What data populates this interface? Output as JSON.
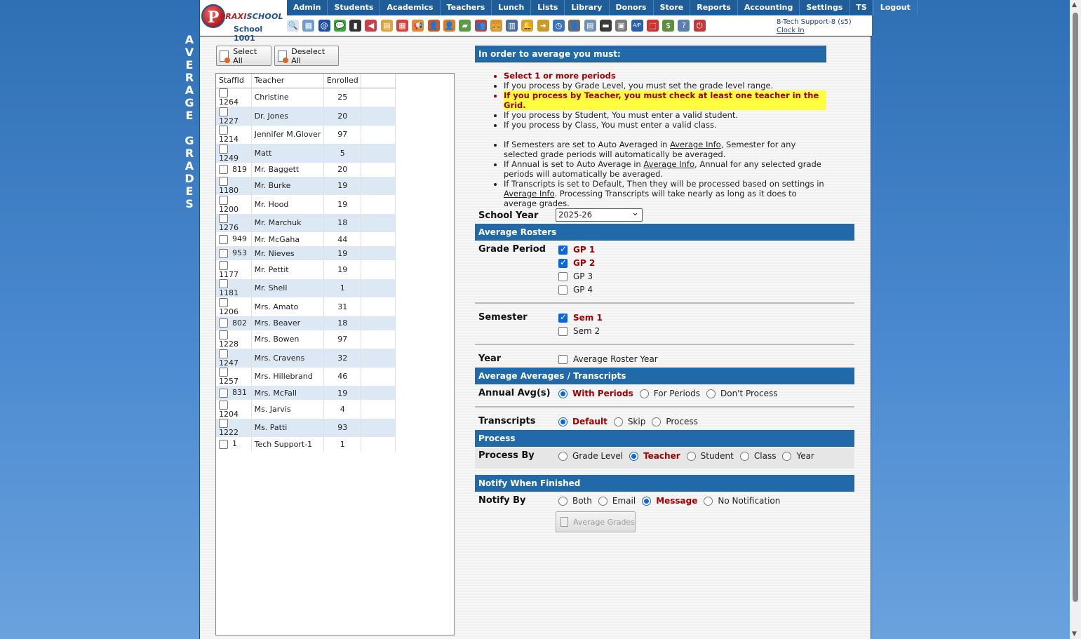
{
  "page": {
    "vertical_title": [
      "A",
      "V",
      "E",
      "R",
      "A",
      "G",
      "E",
      "",
      "G",
      "R",
      "A",
      "D",
      "E",
      "S"
    ]
  },
  "header": {
    "logo_letter": "P",
    "logo_name_a": "PRAXI",
    "logo_name_b": "SCHOOL",
    "school": "School 1001",
    "nav": [
      "Admin",
      "Students",
      "Academics",
      "Teachers",
      "Lunch",
      "Lists",
      "Library",
      "Donors",
      "Store",
      "Reports",
      "Accounting",
      "Settings",
      "TS",
      "Logout"
    ],
    "user": "8-Tech Support-8 (s5)",
    "clock_in": "Clock In",
    "toolbar_icons": [
      {
        "name": "search-icon",
        "glyph": "🔍",
        "color": "#d9e4f2"
      },
      {
        "name": "grid-icon",
        "glyph": "▦",
        "color": "#6f9ccf"
      },
      {
        "name": "email-icon",
        "glyph": "@",
        "color": "#1f4fa8"
      },
      {
        "name": "chat-icon",
        "glyph": "💬",
        "color": "#3fa63f"
      },
      {
        "name": "phone-icon",
        "glyph": "▮",
        "color": "#333"
      },
      {
        "name": "speaker-icon",
        "glyph": "◀",
        "color": "#c7414a"
      },
      {
        "name": "report-icon",
        "glyph": "▤",
        "color": "#d9a441"
      },
      {
        "name": "calendar-icon",
        "glyph": "▦",
        "color": "#d6413c"
      },
      {
        "name": "megaphone-icon",
        "glyph": "📢",
        "color": "#e48a2b"
      },
      {
        "name": "teacher-icon",
        "glyph": "👤",
        "color": "#c05b2b"
      },
      {
        "name": "student-icon",
        "glyph": "👤",
        "color": "#d77b2b"
      },
      {
        "name": "book-icon",
        "glyph": "▰",
        "color": "#5c9a48"
      },
      {
        "name": "group-icon",
        "glyph": "👥",
        "color": "#b5443e"
      },
      {
        "name": "lunch-icon",
        "glyph": "🍔",
        "color": "#d49a2d"
      },
      {
        "name": "list-icon",
        "glyph": "▥",
        "color": "#4b6e98"
      },
      {
        "name": "bell-icon",
        "glyph": "🔔",
        "color": "#d4a52b"
      },
      {
        "name": "export-icon",
        "glyph": "➜",
        "color": "#c79a2a"
      },
      {
        "name": "clock-icon",
        "glyph": "◷",
        "color": "#3b74b8"
      },
      {
        "name": "person-icon",
        "glyph": "👤",
        "color": "#6b6b6b"
      },
      {
        "name": "document-icon",
        "glyph": "▤",
        "color": "#6f8fb3"
      },
      {
        "name": "barcode-icon",
        "glyph": "▬",
        "color": "#3a3a3a"
      },
      {
        "name": "printer-icon",
        "glyph": "▣",
        "color": "#7a7a7a"
      },
      {
        "name": "ap-icon",
        "glyph": "A/P",
        "color": "#2e5fa8"
      },
      {
        "name": "pdf-icon",
        "glyph": "⬚",
        "color": "#c33"
      },
      {
        "name": "money-icon",
        "glyph": "$",
        "color": "#5f8f3e"
      },
      {
        "name": "help-icon",
        "glyph": "?",
        "color": "#5b7fae"
      },
      {
        "name": "power-icon",
        "glyph": "⏻",
        "color": "#c43a3a"
      }
    ]
  },
  "buttons": {
    "select_all": "Select All",
    "deselect_all": "Deselect All",
    "average_grades": "Average Grades"
  },
  "grid": {
    "headers": {
      "staff_id": "StaffId",
      "teacher": "Teacher",
      "enrolled": "Enrolled"
    },
    "rows": [
      {
        "id": "1264",
        "teacher": "Christine",
        "enrolled": "25"
      },
      {
        "id": "1227",
        "teacher": "Dr. Jones",
        "enrolled": "20"
      },
      {
        "id": "1214",
        "teacher": "Jennifer M.Glover",
        "enrolled": "97"
      },
      {
        "id": "1249",
        "teacher": "Matt",
        "enrolled": "5"
      },
      {
        "id": "819",
        "teacher": "Mr. Baggett",
        "enrolled": "20"
      },
      {
        "id": "1180",
        "teacher": "Mr. Burke",
        "enrolled": "19"
      },
      {
        "id": "1200",
        "teacher": "Mr. Hood",
        "enrolled": "19"
      },
      {
        "id": "1276",
        "teacher": "Mr. Marchuk",
        "enrolled": "18"
      },
      {
        "id": "949",
        "teacher": "Mr. McGaha",
        "enrolled": "44"
      },
      {
        "id": "953",
        "teacher": "Mr. Nieves",
        "enrolled": "19"
      },
      {
        "id": "1177",
        "teacher": "Mr. Pettit",
        "enrolled": "19"
      },
      {
        "id": "1181",
        "teacher": "Mr. Shell",
        "enrolled": "1"
      },
      {
        "id": "1206",
        "teacher": "Mrs. Amato",
        "enrolled": "31"
      },
      {
        "id": "802",
        "teacher": "Mrs. Beaver",
        "enrolled": "18"
      },
      {
        "id": "1228",
        "teacher": "Mrs. Bowen",
        "enrolled": "97"
      },
      {
        "id": "1247",
        "teacher": "Mrs. Cravens",
        "enrolled": "32"
      },
      {
        "id": "1257",
        "teacher": "Mrs. Hillebrand",
        "enrolled": "46"
      },
      {
        "id": "831",
        "teacher": "Mrs. McFall",
        "enrolled": "19"
      },
      {
        "id": "1204",
        "teacher": "Ms. Jarvis",
        "enrolled": "4"
      },
      {
        "id": "1222",
        "teacher": "Ms. Patti",
        "enrolled": "93"
      },
      {
        "id": "1",
        "teacher": "Tech Support-1",
        "enrolled": "1"
      }
    ]
  },
  "info": {
    "title": "In order to average you must:",
    "req1": "Select 1 or more periods",
    "req2": "If you process by Grade Level, you must set the grade level range.",
    "req3": "If you process by Teacher, you must check at least one teacher in the Grid.",
    "req4": "If you process by Student, You must enter a valid student.",
    "req5": "If you process by Class, You must enter a valid class.",
    "note1_a": "If Semesters are set to Auto Averaged in ",
    "note1_link": "Average Info",
    "note1_b": ", Semester for any selected grade periods will automatically be averaged.",
    "note2_a": "If Annual is set to Auto Average in ",
    "note2_link": "Average Info",
    "note2_b": ", Annual for any selected grade periods will automatically be averaged.",
    "note3_a": "If Transcripts is set to Default, Then they will be processed based on settings in ",
    "note3_link": "Average Info",
    "note3_b": ". Processing Transcripts will take nearly as long as it does to average grades."
  },
  "form": {
    "school_year_label": "School Year",
    "school_year_value": "2025-26",
    "average_rosters": "Average Rosters",
    "grade_period_label": "Grade Period",
    "gp1": "GP 1",
    "gp2": "GP 2",
    "gp3": "GP 3",
    "gp4": "GP 4",
    "semester_label": "Semester",
    "sem1": "Sem 1",
    "sem2": "Sem 2",
    "year_label": "Year",
    "avg_roster_year": "Average Roster Year",
    "averages_transcripts": "Average Averages / Transcripts",
    "annual_label": "Annual Avg(s)",
    "with_periods": "With Periods",
    "for_periods": "For Periods",
    "dont_process": "Don't Process",
    "transcripts_label": "Transcripts",
    "t_default": "Default",
    "t_skip": "Skip",
    "t_process": "Process",
    "process_section": "Process",
    "process_by_label": "Process By",
    "p_grade_level": "Grade Level",
    "p_teacher": "Teacher",
    "p_student": "Student",
    "p_class": "Class",
    "p_year": "Year",
    "notify_section": "Notify When Finished",
    "notify_by_label": "Notify By",
    "n_both": "Both",
    "n_email": "Email",
    "n_message": "Message",
    "n_none": "No Notification"
  }
}
